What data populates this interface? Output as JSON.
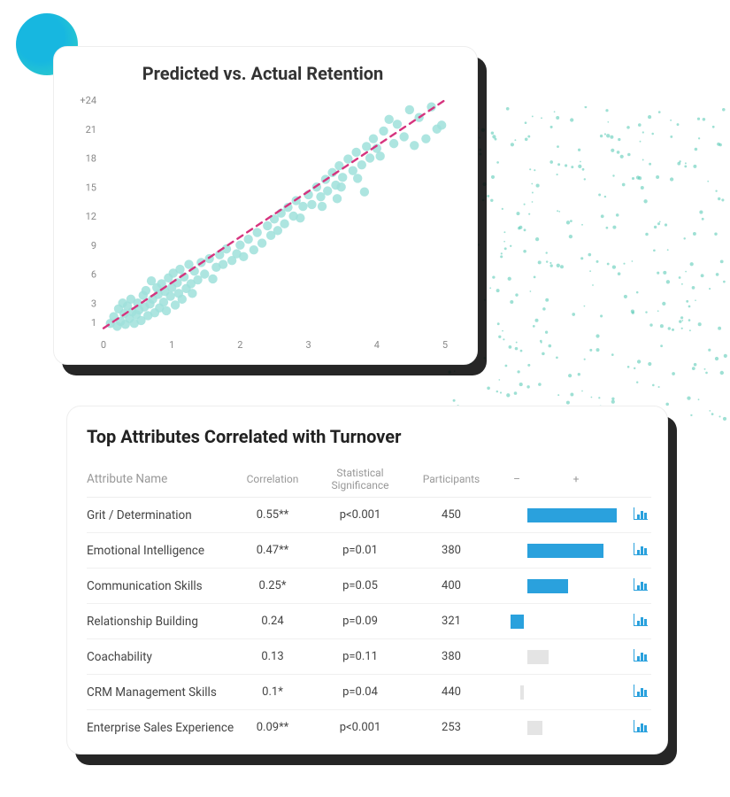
{
  "chart_data": {
    "type": "scatter",
    "title": "Predicted vs. Actual Retention",
    "xlabel": "",
    "ylabel": "",
    "xlim": [
      0,
      5
    ],
    "ylim": [
      0,
      24
    ],
    "x_ticks": [
      0,
      1,
      2,
      3,
      4,
      5
    ],
    "y_ticks": [
      "1",
      "3",
      "6",
      "9",
      "12",
      "15",
      "18",
      "21",
      "+24"
    ],
    "trend_line": {
      "x1": 0.0,
      "y1": 0.4,
      "x2": 5.0,
      "y2": 24.0,
      "color": "#d6347e",
      "dashed": true
    },
    "points": [
      [
        0.1,
        0.9
      ],
      [
        0.15,
        1.6
      ],
      [
        0.2,
        0.6
      ],
      [
        0.22,
        2.4
      ],
      [
        0.25,
        1.1
      ],
      [
        0.28,
        3.0
      ],
      [
        0.3,
        1.9
      ],
      [
        0.32,
        0.8
      ],
      [
        0.35,
        2.7
      ],
      [
        0.38,
        1.4
      ],
      [
        0.4,
        3.4
      ],
      [
        0.42,
        2.1
      ],
      [
        0.45,
        0.9
      ],
      [
        0.48,
        1.8
      ],
      [
        0.5,
        3.0
      ],
      [
        0.52,
        2.3
      ],
      [
        0.55,
        1.2
      ],
      [
        0.58,
        3.8
      ],
      [
        0.6,
        2.6
      ],
      [
        0.62,
        4.3
      ],
      [
        0.65,
        1.7
      ],
      [
        0.68,
        2.9
      ],
      [
        0.7,
        5.3
      ],
      [
        0.72,
        3.4
      ],
      [
        0.75,
        2.0
      ],
      [
        0.78,
        4.6
      ],
      [
        0.8,
        3.9
      ],
      [
        0.82,
        2.5
      ],
      [
        0.85,
        5.0
      ],
      [
        0.88,
        3.1
      ],
      [
        0.9,
        4.2
      ],
      [
        0.92,
        2.2
      ],
      [
        0.95,
        5.6
      ],
      [
        0.98,
        3.7
      ],
      [
        1.0,
        4.6
      ],
      [
        1.02,
        6.1
      ],
      [
        1.05,
        2.8
      ],
      [
        1.08,
        5.1
      ],
      [
        1.1,
        4.0
      ],
      [
        1.12,
        6.5
      ],
      [
        1.15,
        3.4
      ],
      [
        1.18,
        5.7
      ],
      [
        1.21,
        4.5
      ],
      [
        1.25,
        7.0
      ],
      [
        1.28,
        5.0
      ],
      [
        1.3,
        4.0
      ],
      [
        1.33,
        6.3
      ],
      [
        1.38,
        5.4
      ],
      [
        1.43,
        7.2
      ],
      [
        1.48,
        6.0
      ],
      [
        1.55,
        7.6
      ],
      [
        1.6,
        5.5
      ],
      [
        1.65,
        6.7
      ],
      [
        1.7,
        8.0
      ],
      [
        1.75,
        7.0
      ],
      [
        1.8,
        8.6
      ],
      [
        1.88,
        7.4
      ],
      [
        1.95,
        8.1
      ],
      [
        2.0,
        9.0
      ],
      [
        2.05,
        7.8
      ],
      [
        2.12,
        9.6
      ],
      [
        2.2,
        8.5
      ],
      [
        2.25,
        10.3
      ],
      [
        2.32,
        9.2
      ],
      [
        2.4,
        11.0
      ],
      [
        2.45,
        10.0
      ],
      [
        2.5,
        11.7
      ],
      [
        2.55,
        10.5
      ],
      [
        2.6,
        12.3
      ],
      [
        2.65,
        11.2
      ],
      [
        2.7,
        12.9
      ],
      [
        2.78,
        12.0
      ],
      [
        2.82,
        13.6
      ],
      [
        2.88,
        11.8
      ],
      [
        2.92,
        13.0
      ],
      [
        3.0,
        14.2
      ],
      [
        3.05,
        13.2
      ],
      [
        3.12,
        15.0
      ],
      [
        3.18,
        14.0
      ],
      [
        3.2,
        13.0
      ],
      [
        3.25,
        15.8
      ],
      [
        3.28,
        14.6
      ],
      [
        3.35,
        16.5
      ],
      [
        3.4,
        15.2
      ],
      [
        3.42,
        13.8
      ],
      [
        3.45,
        17.2
      ],
      [
        3.48,
        15.0
      ],
      [
        3.5,
        16.0
      ],
      [
        3.58,
        17.9
      ],
      [
        3.65,
        16.7
      ],
      [
        3.7,
        18.6
      ],
      [
        3.72,
        15.9
      ],
      [
        3.78,
        17.3
      ],
      [
        3.82,
        14.5
      ],
      [
        3.85,
        19.2
      ],
      [
        3.9,
        18.0
      ],
      [
        3.95,
        20.0
      ],
      [
        4.0,
        19.0
      ],
      [
        4.05,
        18.2
      ],
      [
        4.1,
        20.8
      ],
      [
        4.18,
        22.0
      ],
      [
        4.25,
        19.5
      ],
      [
        4.3,
        21.5
      ],
      [
        4.4,
        20.2
      ],
      [
        4.48,
        23.0
      ],
      [
        4.55,
        19.3
      ],
      [
        4.62,
        22.2
      ],
      [
        4.72,
        20.0
      ],
      [
        4.8,
        23.3
      ],
      [
        4.88,
        21.0
      ],
      [
        4.95,
        21.4
      ]
    ]
  },
  "table": {
    "title": "Top Attributes Correlated with Turnover",
    "headers": {
      "name": "Attribute Name",
      "corr": "Correlation",
      "sig": "Statistical Significance",
      "part": "Participants",
      "minus": "–",
      "plus": "+"
    },
    "bar_scale": 0.6,
    "rows": [
      {
        "name": "Grit / Determination",
        "corr": "0.55**",
        "sig": "p<0.001",
        "part": "450",
        "bar": 0.55,
        "color": "blue"
      },
      {
        "name": "Emotional Intelligence",
        "corr": "0.47**",
        "sig": "p=0.01",
        "part": "380",
        "bar": 0.47,
        "color": "blue"
      },
      {
        "name": "Communication Skills",
        "corr": "0.25*",
        "sig": "p=0.05",
        "part": "400",
        "bar": 0.25,
        "color": "blue"
      },
      {
        "name": "Relationship Building",
        "corr": "0.24",
        "sig": "p=0.09",
        "part": "321",
        "bar": -0.24,
        "color": "blue"
      },
      {
        "name": "Coachability",
        "corr": "0.13",
        "sig": "p=0.11",
        "part": "380",
        "bar": 0.13,
        "color": "gray"
      },
      {
        "name": "CRM Management Skills",
        "corr": "0.1*",
        "sig": "p=0.04",
        "part": "440",
        "bar": -0.07,
        "color": "gray"
      },
      {
        "name": "Enterprise Sales Experience",
        "corr": "0.09**",
        "sig": "p<0.001",
        "part": "253",
        "bar": 0.09,
        "color": "gray"
      }
    ]
  }
}
